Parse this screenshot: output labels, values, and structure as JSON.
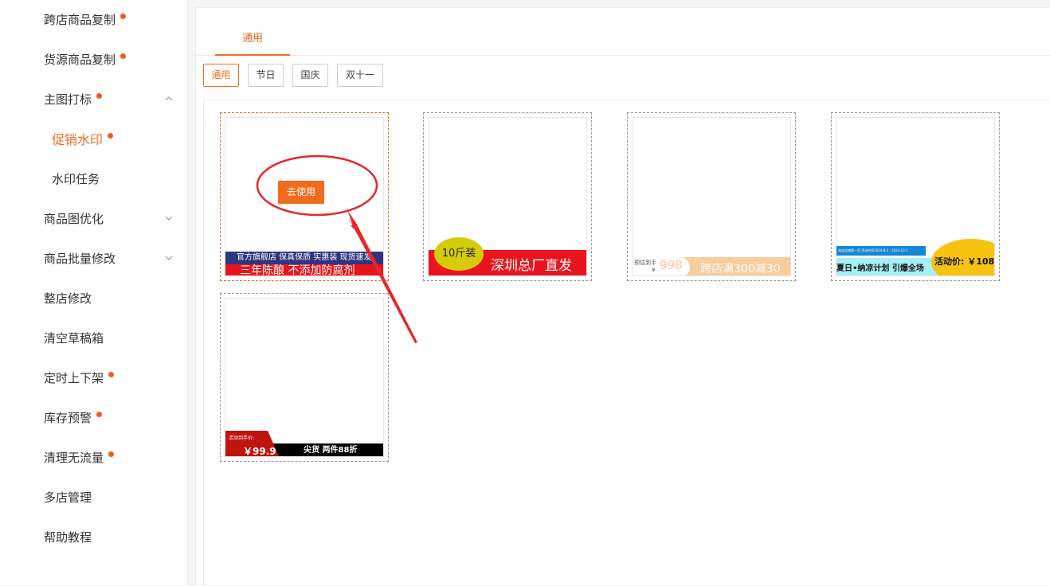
{
  "sidebar": {
    "items": [
      {
        "label": "跨店商品复制"
      },
      {
        "label": "货源商品复制"
      },
      {
        "label": "主图打标"
      },
      {
        "label": "促销水印"
      },
      {
        "label": "水印任务"
      },
      {
        "label": "商品图优化"
      },
      {
        "label": "商品批量修改"
      },
      {
        "label": "整店修改"
      },
      {
        "label": "清空草稿箱"
      },
      {
        "label": "定时上下架"
      },
      {
        "label": "库存预警"
      },
      {
        "label": "清理无流量"
      },
      {
        "label": "多店管理"
      },
      {
        "label": "帮助教程"
      }
    ]
  },
  "main": {
    "tab": "通用",
    "filters": [
      "通用",
      "节日",
      "国庆",
      "双十一"
    ]
  },
  "templates": {
    "use_label": "去使用",
    "t1": {
      "top": "官方旗舰店  保真保质  实惠装  现货速发",
      "bottom": "三年陈酿   不添加防腐剂"
    },
    "t2": {
      "badge": "10斤装",
      "text": "深圳总厂直发"
    },
    "t3": {
      "label": "预估到手",
      "yen": "¥",
      "price": "998",
      "text": "跨店满300减30"
    },
    "t4": {
      "small": "淘宝店铺第一页  活动时间2024.8.1 - 2024.10.1",
      "text": "夏日•纳凉计划 引爆全场",
      "price": "活动价: ￥108"
    },
    "t5": {
      "label": "活动到手价:",
      "price": "￥99.9",
      "text": "尖货  两件88折"
    }
  },
  "colors": {
    "accent": "#f26b1d",
    "dot": "#f15a22",
    "annotation": "#e8262a"
  }
}
